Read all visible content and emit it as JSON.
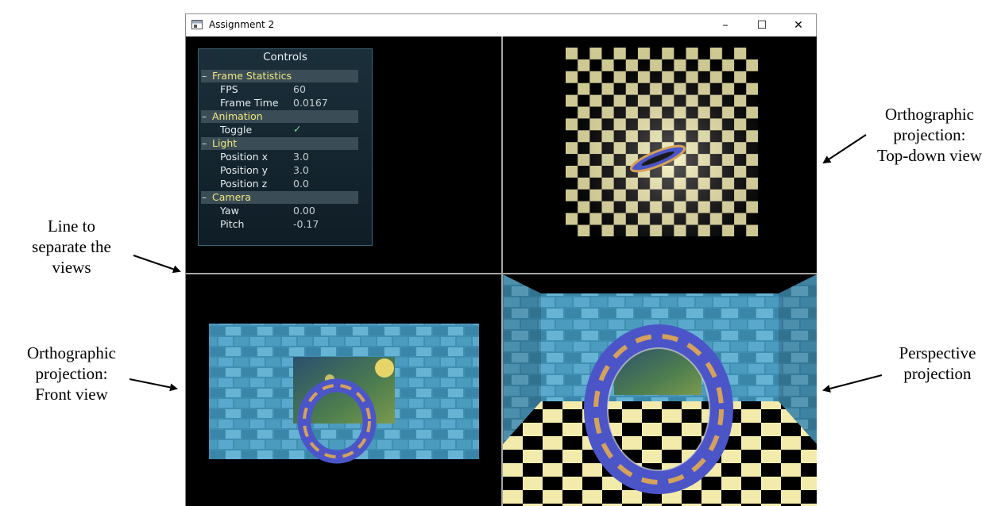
{
  "window": {
    "title": "Assignment 2",
    "minimize_glyph": "–",
    "maximize_glyph": "☐",
    "close_glyph": "✕"
  },
  "controls": {
    "title": "Controls",
    "frame_stats": {
      "label": "Frame Statistics",
      "fps_label": "FPS",
      "fps_value": "60",
      "frame_time_label": "Frame Time",
      "frame_time_value": "0.0167"
    },
    "animation": {
      "label": "Animation",
      "toggle_label": "Toggle",
      "toggle_value": "✓"
    },
    "light": {
      "label": "Light",
      "px_label": "Position x",
      "px_value": "3.0",
      "py_label": "Position y",
      "py_value": "3.0",
      "pz_label": "Position z",
      "pz_value": "0.0"
    },
    "camera": {
      "label": "Camera",
      "yaw_label": "Yaw",
      "yaw_value": "0.00",
      "pitch_label": "Pitch",
      "pitch_value": "-0.17"
    },
    "collapse_glyph": "–"
  },
  "annotations": {
    "top_right": [
      "Orthographic",
      "projection:",
      "Top-down view"
    ],
    "left_separator": [
      "Line to",
      "separate the",
      "views"
    ],
    "left_front": [
      "Orthographic",
      "projection:",
      "Front view"
    ],
    "right_perspective": [
      "Perspective",
      "projection"
    ]
  },
  "colors": {
    "checker_light": "#f2ebac",
    "checker_dark": "#000000",
    "wall": "#3f8fb3",
    "ring_blue": "#4b55c8",
    "ring_gold": "#d6a15a",
    "accent_yellow": "#f1e77e"
  }
}
